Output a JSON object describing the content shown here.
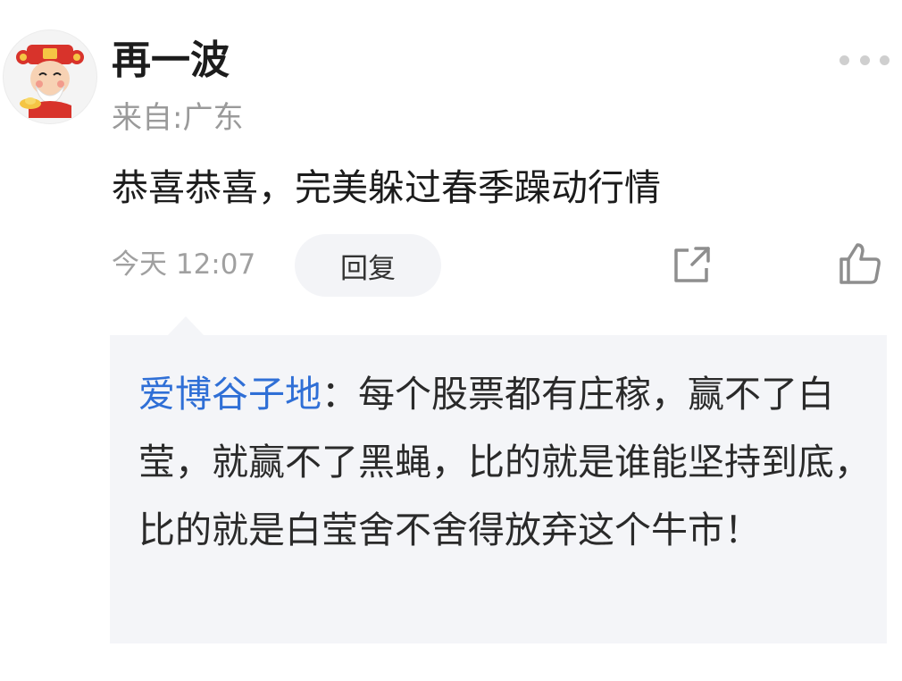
{
  "comment": {
    "username": "再一波",
    "location": "来自:广东",
    "content": "恭喜恭喜，完美躲过春季躁动行情",
    "time": "今天 12:07",
    "reply_label": "回复",
    "more_icon": "more-dots-icon",
    "share_icon": "share-icon",
    "like_icon": "thumbs-up-icon",
    "avatar": "avatar-god-of-wealth"
  },
  "quoted_reply": {
    "author": "爱博谷子地",
    "separator": "：",
    "text": "每个股票都有庄稼，赢不了白莹，就赢不了黑蝇，比的就是谁能坚持到底，比的就是白莹舍不舍得放弃这个牛市！"
  },
  "colors": {
    "link_blue": "#2f6fd6",
    "quote_bg": "#f4f5f8",
    "secondary_text": "#9a9a9a",
    "reply_btn_bg": "#f3f4f7"
  }
}
